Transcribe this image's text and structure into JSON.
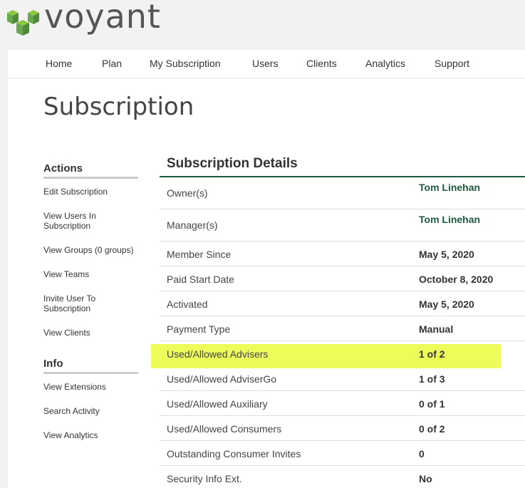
{
  "brand": {
    "name": "voyant",
    "colors": {
      "logo_light": "#8dc63f",
      "logo_mid": "#6aa84f",
      "logo_dark": "#4e8a3a",
      "accent": "#1f5a3e",
      "highlight": "#eefc5a"
    }
  },
  "nav": {
    "items": [
      "Home",
      "Plan",
      "My Subscription",
      "Users",
      "Clients",
      "Analytics",
      "Support"
    ]
  },
  "page": {
    "title": "Subscription"
  },
  "sidebar": {
    "actions_heading": "Actions",
    "actions": [
      "Edit Subscription",
      "View Users In Subscription",
      "View Groups (0 groups)",
      "View Teams",
      "Invite User To Subscription",
      "View Clients"
    ],
    "info_heading": "Info",
    "info": [
      "View Extensions",
      "Search Activity",
      "View Analytics"
    ]
  },
  "details": {
    "title": "Subscription Details",
    "rows": [
      {
        "label": "Owner(s)",
        "value": "Tom Linehan"
      },
      {
        "label": "Manager(s)",
        "value": "Tom Linehan"
      },
      {
        "label": "Member Since",
        "value": "May 5, 2020"
      },
      {
        "label": "Paid Start Date",
        "value": "October 8, 2020"
      },
      {
        "label": "Activated",
        "value": "May 5, 2020"
      },
      {
        "label": "Payment Type",
        "value": "Manual"
      },
      {
        "label": "Used/Allowed Advisers",
        "value": "1 of 2"
      },
      {
        "label": "Used/Allowed AdviserGo",
        "value": "1 of 3"
      },
      {
        "label": "Used/Allowed Auxiliary",
        "value": "0 of 1"
      },
      {
        "label": "Used/Allowed Consumers",
        "value": "0 of 2"
      },
      {
        "label": "Outstanding Consumer Invites",
        "value": "0"
      },
      {
        "label": "Security Info Ext.",
        "value": "No"
      }
    ]
  }
}
